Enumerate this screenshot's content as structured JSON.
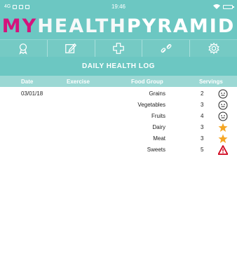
{
  "status_bar": {
    "carrier_text": "4G",
    "time": "19:46"
  },
  "brand": {
    "my": "MY",
    "health": "HEALTH",
    "pyramid": "PYRAMID",
    "colors": {
      "my": "#d4137c",
      "bar": "#6cc7c2"
    }
  },
  "icon_bar": {
    "items": [
      "ribbon-icon",
      "edit-icon",
      "plus-icon",
      "link-icon",
      "settings-icon"
    ]
  },
  "log": {
    "title": "DAILY HEALTH LOG",
    "headers": {
      "date": "Date",
      "exercise": "Exercise",
      "food_group": "Food Group",
      "servings": "Servings"
    },
    "rows": [
      {
        "date": "03/01/18",
        "exercise": "",
        "food_group": "Grains",
        "servings": "2",
        "icon": "neutral-face-icon"
      },
      {
        "date": "",
        "exercise": "",
        "food_group": "Vegetables",
        "servings": "3",
        "icon": "neutral-face-icon"
      },
      {
        "date": "",
        "exercise": "",
        "food_group": "Fruits",
        "servings": "4",
        "icon": "neutral-face-icon"
      },
      {
        "date": "",
        "exercise": "",
        "food_group": "Dairy",
        "servings": "3",
        "icon": "star-icon"
      },
      {
        "date": "",
        "exercise": "",
        "food_group": "Meat",
        "servings": "3",
        "icon": "star-icon"
      },
      {
        "date": "",
        "exercise": "",
        "food_group": "Sweets",
        "servings": "5",
        "icon": "warning-icon"
      }
    ]
  }
}
